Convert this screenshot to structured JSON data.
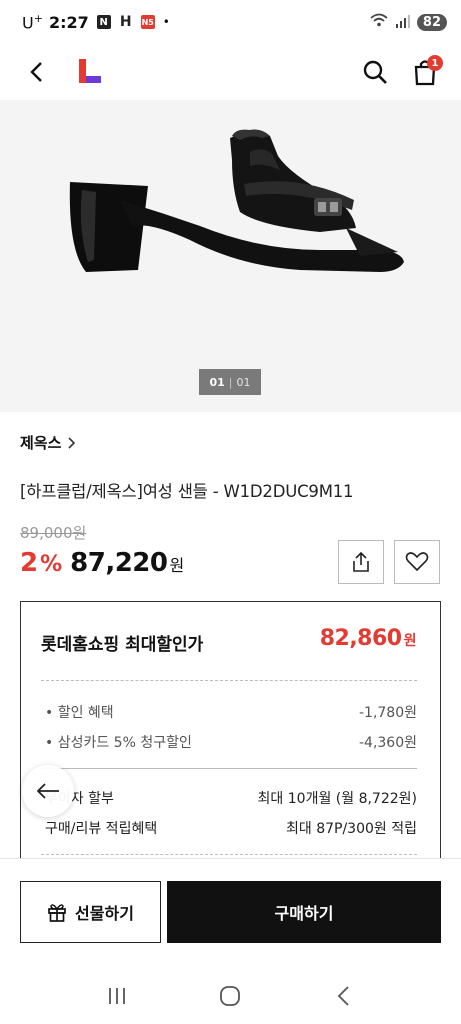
{
  "status_bar": {
    "carrier": "U",
    "carrier_sup": "+",
    "time": "2:27",
    "notif_icons": [
      "N",
      "H",
      "N5"
    ],
    "dot": "•",
    "battery": "82"
  },
  "header": {
    "cart_count": "1",
    "logo_color": "#e23b32",
    "logo_accent": "#6a3bd6"
  },
  "hero": {
    "pager_current": "01",
    "pager_sep": "|",
    "pager_total": "01"
  },
  "product": {
    "brand": "제옥스",
    "title": "[하프클럽/제옥스]여성 샌들 - W1D2DUC9M11",
    "original_price": "89,000원",
    "discount_rate": "2",
    "discount_pct": "%",
    "price": "87,220",
    "price_unit": "원"
  },
  "discount": {
    "heading": "롯데홈쇼핑 최대할인가",
    "best_price": "82,860",
    "best_unit": "원",
    "rows": [
      {
        "label": "• 할인 혜택",
        "value": "-1,780원"
      },
      {
        "label": "• 삼성카드 5% 청구할인",
        "value": "-4,360원"
      }
    ],
    "info": [
      {
        "label": "무이자 할부",
        "value": "최대 10개월 (월 8,722원)"
      },
      {
        "label": "구매/리뷰 적립혜택",
        "value": "최대 87P/300원 적립"
      }
    ]
  },
  "bottom": {
    "gift_label": "선물하기",
    "buy_label": "구매하기"
  },
  "colors": {
    "accent_red": "#e23b32",
    "dark": "#111111"
  }
}
